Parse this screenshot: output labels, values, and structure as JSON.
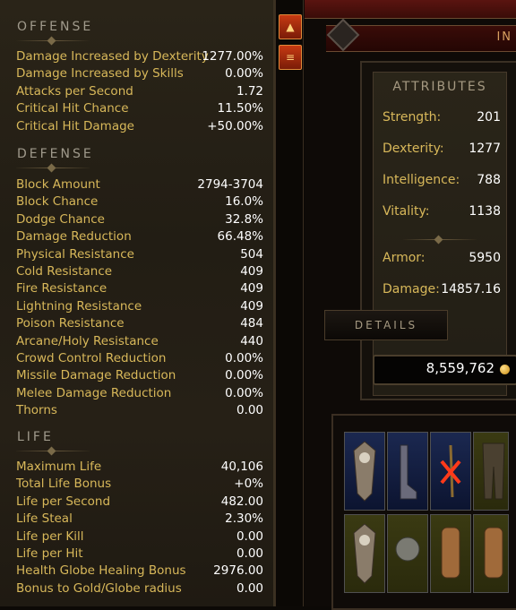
{
  "offense": {
    "title": "OFFENSE",
    "rows": [
      {
        "label": "Damage Increased by Dexterity",
        "value": "1277.00%"
      },
      {
        "label": "Damage Increased by Skills",
        "value": "0.00%"
      },
      {
        "label": "Attacks per Second",
        "value": "1.72"
      },
      {
        "label": "Critical Hit Chance",
        "value": "11.50%"
      },
      {
        "label": "Critical Hit Damage",
        "value": "+50.00%"
      }
    ]
  },
  "defense": {
    "title": "DEFENSE",
    "rows": [
      {
        "label": "Block Amount",
        "value": "2794-3704"
      },
      {
        "label": "Block Chance",
        "value": "16.0%"
      },
      {
        "label": "Dodge Chance",
        "value": "32.8%"
      },
      {
        "label": "Damage Reduction",
        "value": "66.48%"
      },
      {
        "label": "Physical Resistance",
        "value": "504"
      },
      {
        "label": "Cold Resistance",
        "value": "409"
      },
      {
        "label": "Fire Resistance",
        "value": "409"
      },
      {
        "label": "Lightning Resistance",
        "value": "409"
      },
      {
        "label": "Poison Resistance",
        "value": "484"
      },
      {
        "label": "Arcane/Holy Resistance",
        "value": "440"
      },
      {
        "label": "Crowd Control Reduction",
        "value": "0.00%"
      },
      {
        "label": "Missile Damage Reduction",
        "value": "0.00%"
      },
      {
        "label": "Melee Damage Reduction",
        "value": "0.00%"
      },
      {
        "label": "Thorns",
        "value": "0.00"
      }
    ]
  },
  "life": {
    "title": "LIFE",
    "rows": [
      {
        "label": "Maximum Life",
        "value": "40,106"
      },
      {
        "label": "Total Life Bonus",
        "value": "+0%"
      },
      {
        "label": "Life per Second",
        "value": "482.00"
      },
      {
        "label": "Life Steal",
        "value": "2.30%"
      },
      {
        "label": "Life per Kill",
        "value": "0.00"
      },
      {
        "label": "Life per Hit",
        "value": "0.00"
      },
      {
        "label": "Health Globe Healing Bonus",
        "value": "2976.00"
      },
      {
        "label": "Bonus to Gold/Globe radius",
        "value": "0.00"
      }
    ]
  },
  "header": {
    "tab_text": "IN"
  },
  "attributes": {
    "title": "ATTRIBUTES",
    "rows": [
      {
        "label": "Strength:",
        "value": "201"
      },
      {
        "label": "Dexterity:",
        "value": "1277"
      },
      {
        "label": "Intelligence:",
        "value": "788"
      },
      {
        "label": "Vitality:",
        "value": "1138"
      }
    ],
    "armor": {
      "label": "Armor:",
      "value": "5950"
    },
    "damage": {
      "label": "Damage:",
      "value": "14857.16"
    },
    "details_label": "DETAILS"
  },
  "gold": {
    "amount": "8,559,762"
  },
  "icons": {
    "scroll_up": "arrow-up-icon",
    "scroll_thumb": "scroll-thumb-icon",
    "gold": "gold-coin-icon"
  },
  "colors": {
    "label": "#d8b85a",
    "value": "#ffffff",
    "heading": "#a09a8c",
    "scroll_accent": "#c63a12"
  }
}
